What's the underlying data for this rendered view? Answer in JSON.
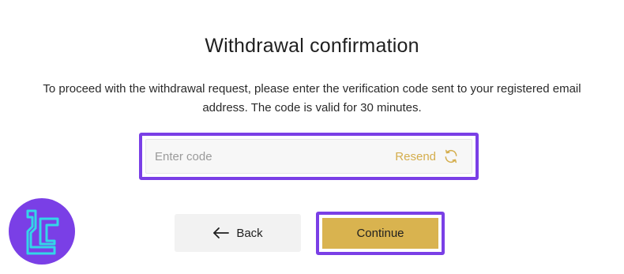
{
  "dialog": {
    "title": "Withdrawal confirmation",
    "description": "To proceed with the withdrawal request, please enter the verification code sent to your registered email address. The code is valid for 30 minutes."
  },
  "code_field": {
    "placeholder": "Enter code",
    "value": "",
    "resend_label": "Resend",
    "resend_icon": "refresh-icon"
  },
  "actions": {
    "back_label": "Back",
    "back_icon": "arrow-left-icon",
    "continue_label": "Continue"
  },
  "colors": {
    "accent": "#d9b34f",
    "resend_text": "#d4ad4c",
    "highlight_border": "#7a3fe6",
    "logo_background": "#7a3fe6",
    "logo_mark": "#33d6e8"
  },
  "logo": {
    "icon": "brand-logo-icon"
  }
}
